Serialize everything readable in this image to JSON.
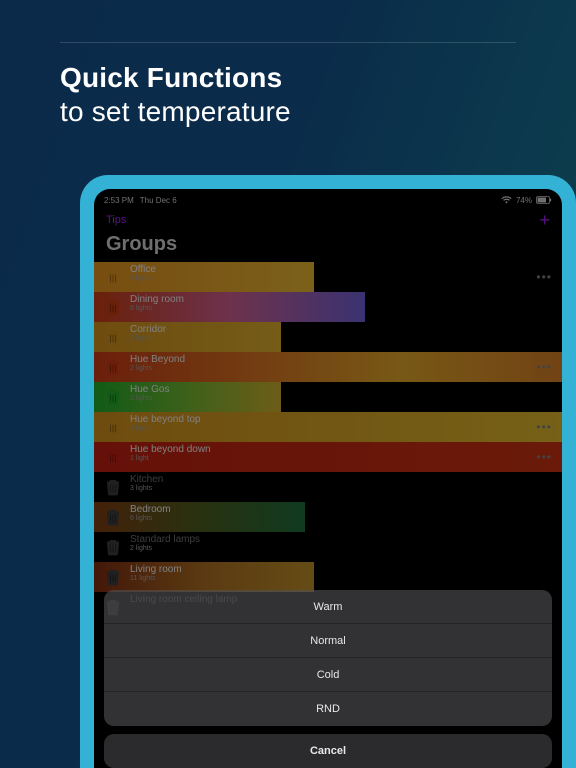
{
  "marketing": {
    "line1": "Quick Functions",
    "line2": "to set temperature"
  },
  "status": {
    "time": "2:53 PM",
    "date": "Thu Dec 6",
    "battery": "74%"
  },
  "nav": {
    "tips": "Tips",
    "plus": "+"
  },
  "title": "Groups",
  "groups": [
    {
      "name": "Office",
      "sub": "3 lights",
      "handle": "#d98c1e",
      "bar_css": "width:47%; background: linear-gradient(90deg,#d98c1e,#e0b030);",
      "show_more": true,
      "dim": false
    },
    {
      "name": "Dining room",
      "sub": "6 lights",
      "handle": "#c03a12",
      "bar_css": "width:58%; background: linear-gradient(90deg,#c03a12,#c75a8a,#6a5acd);",
      "show_more": false,
      "dim": false
    },
    {
      "name": "Corridor",
      "sub": "2 lights",
      "handle": "#c88a1c",
      "bar_css": "width:40%; background: linear-gradient(90deg,#c88a1c,#d4a82a);",
      "show_more": false,
      "dim": false
    },
    {
      "name": "Hue Beyond",
      "sub": "2 lights",
      "handle": "#c23814",
      "bar_css": "width:100%; background: linear-gradient(90deg,#c23814 0%,#d07020 35%,#d9a028 65%,#cf7a24 100%);",
      "show_more": true,
      "dim": false
    },
    {
      "name": "Hue Gos",
      "sub": "2 lights",
      "handle": "#1fa528",
      "bar_css": "width:40%; background: linear-gradient(90deg,#1fa528,#6fb030,#c7a82a);",
      "show_more": false,
      "dim": false
    },
    {
      "name": "Hue beyond top",
      "sub": "1 light",
      "handle": "#c88a1c",
      "bar_css": "width:100%; background: linear-gradient(90deg,#c88a1c,#d6b02a);",
      "show_more": true,
      "dim": false
    },
    {
      "name": "Hue beyond down",
      "sub": "1 light",
      "handle": "#b81e10",
      "bar_css": "width:100%; background: linear-gradient(90deg,#b81e10,#c23010);",
      "show_more": true,
      "dim": false
    },
    {
      "name": "Kitchen",
      "sub": "3 lights",
      "handle": "#3a3a3a",
      "bar_css": "width:0%;",
      "show_more": false,
      "dim": true
    },
    {
      "name": "Bedroom",
      "sub": "6 lights",
      "handle": "#3a3a3a",
      "bar_css": "width:45%; background: linear-gradient(90deg,#7a3a10,#4a5a1e,#1e6a3a);",
      "show_more": false,
      "dim": false
    },
    {
      "name": "Standard lamps",
      "sub": "2 lights",
      "handle": "#3a3a3a",
      "bar_css": "width:0%;",
      "show_more": false,
      "dim": true
    },
    {
      "name": "Living room",
      "sub": "11 lights",
      "handle": "#3a3a3a",
      "bar_css": "width:47%; background: linear-gradient(90deg,#7a2a10,#a66a20,#b88a28);",
      "show_more": false,
      "dim": false
    },
    {
      "name": "Living room ceiling lamp",
      "sub": "",
      "handle": "#3a3a3a",
      "bar_css": "width:0%;",
      "show_more": false,
      "dim": true
    }
  ],
  "sheet": {
    "items": [
      "Warm",
      "Normal",
      "Cold",
      "RND"
    ],
    "cancel": "Cancel"
  }
}
